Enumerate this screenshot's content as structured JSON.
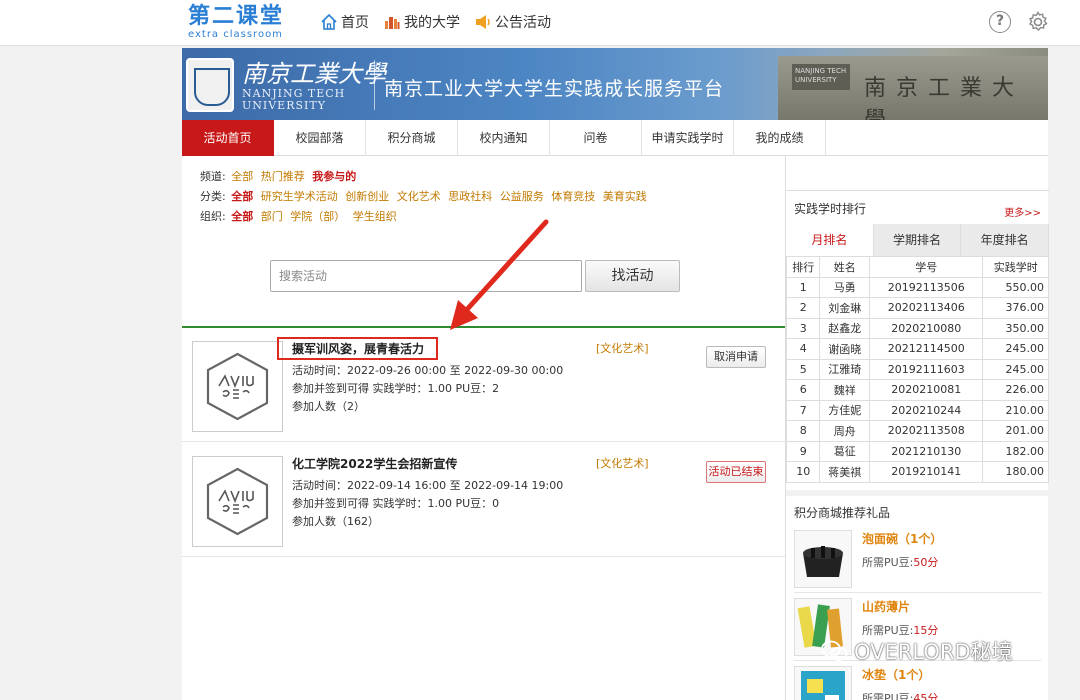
{
  "logo": {
    "cn": "第二课堂",
    "en": "extra classroom"
  },
  "topnav": {
    "home": "首页",
    "university": "我的大学",
    "notice": "公告活动"
  },
  "banner": {
    "uni_cn": "南京工業大學",
    "uni_en_line1": "NANJING TECH",
    "uni_en_line2": "UNIVERSITY",
    "platform": "南京工业大学大学生实践成长服务平台",
    "gate_plaque": "NANJING TECH UNIVERSITY",
    "gate_chars": "南京工業大學"
  },
  "mainnav": [
    "活动首页",
    "校园部落",
    "积分商城",
    "校内通知",
    "问卷",
    "申请实践学时",
    "我的成绩"
  ],
  "filters": {
    "channel": {
      "label": "频道:",
      "options": [
        "全部",
        "热门推荐"
      ],
      "selected": "我参与的"
    },
    "category": {
      "label": "分类:",
      "selected": "全部",
      "options": [
        "研究生学术活动",
        "创新创业",
        "文化艺术",
        "思政社科",
        "公益服务",
        "体育竞技",
        "美育实践"
      ]
    },
    "org": {
      "label": "组织:",
      "selected": "全部",
      "options": [
        "部门",
        "学院（部）",
        "学生组织"
      ]
    }
  },
  "search": {
    "placeholder": "搜索活动",
    "button": "找活动"
  },
  "activities": [
    {
      "title": "摄军训风姿，展青春活力",
      "category": "[文化艺术]",
      "time": "活动时间：2022-09-26 00:00 至 2022-09-30 00:00",
      "credit": "参加并签到可得 实践学时：1.00 PU豆：2",
      "count": "参加人数（2）",
      "button": "取消申请"
    },
    {
      "title": "化工学院2022学生会招新宣传",
      "category": "[文化艺术]",
      "time": "活动时间：2022-09-14 16:00 至 2022-09-14 19:00",
      "credit": "参加并签到可得 实践学时：1.00 PU豆：0",
      "count": "参加人数（162）",
      "button": "活动已结束"
    }
  ],
  "ranking": {
    "title": "实践学时排行",
    "more": "更多>>",
    "tabs": [
      "月排名",
      "学期排名",
      "年度排名"
    ],
    "headers": [
      "排行",
      "姓名",
      "学号",
      "实践学时"
    ],
    "rows": [
      [
        "1",
        "马勇",
        "20192113506",
        "550.00"
      ],
      [
        "2",
        "刘金琳",
        "20202113406",
        "376.00"
      ],
      [
        "3",
        "赵鑫龙",
        "2020210080",
        "350.00"
      ],
      [
        "4",
        "谢函晓",
        "20212114500",
        "245.00"
      ],
      [
        "5",
        "江雅琦",
        "20192111603",
        "245.00"
      ],
      [
        "6",
        "魏祥",
        "2020210081",
        "226.00"
      ],
      [
        "7",
        "方佳妮",
        "2020210244",
        "210.00"
      ],
      [
        "8",
        "周舟",
        "20202113508",
        "201.00"
      ],
      [
        "9",
        "葛征",
        "2021210130",
        "182.00"
      ],
      [
        "10",
        "蒋美祺",
        "2019210141",
        "180.00"
      ]
    ]
  },
  "gifts": {
    "title": "积分商城推荐礼品",
    "items": [
      {
        "name": "泡面碗（1个）",
        "pu_label": "所需PU豆:",
        "pu_value": "50分"
      },
      {
        "name": "山药薄片",
        "pu_label": "所需PU豆:",
        "pu_value": "15分"
      },
      {
        "name": "冰垫（1个）",
        "pu_label": "所需PU豆:",
        "pu_value": "45分"
      }
    ]
  },
  "watermark": "OVERLORD秘境",
  "colors": {
    "accent_red": "#c8191a",
    "link_orange": "#c27a00",
    "brand_blue": "#2a7fd4",
    "divider_green": "#2e8b30"
  }
}
